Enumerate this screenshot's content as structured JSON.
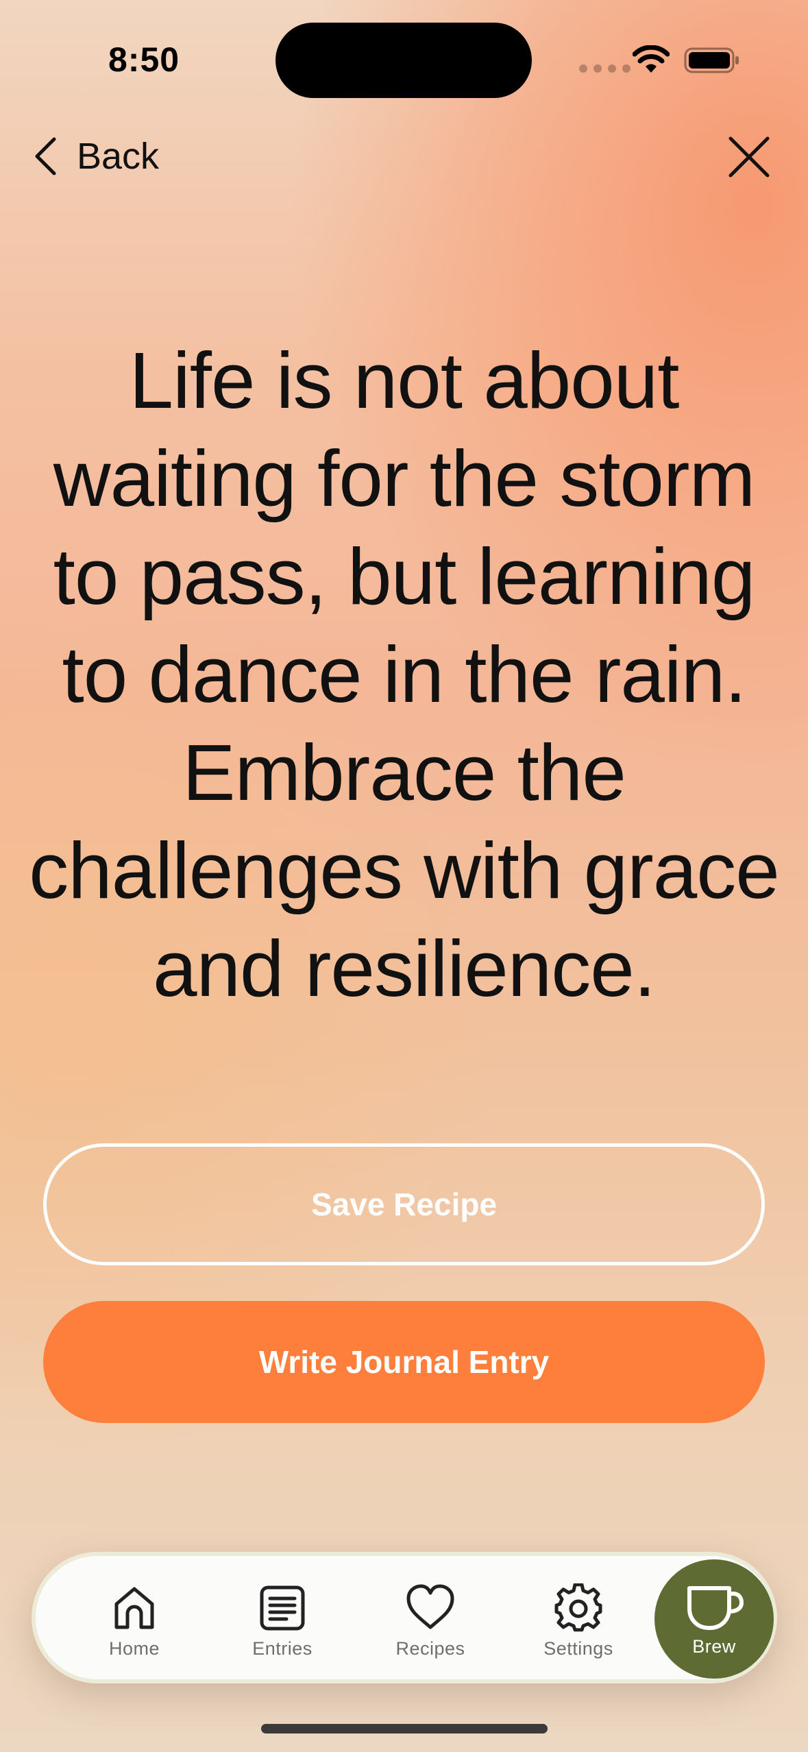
{
  "status_bar": {
    "time": "8:50"
  },
  "nav": {
    "back_label": "Back",
    "back_icon": "chevron-left-icon",
    "close_icon": "close-icon"
  },
  "quote": {
    "text": "Life is not about waiting for the storm to pass, but learning to dance in the rain. Embrace the challenges with grace and resilience."
  },
  "actions": {
    "save_recipe_label": "Save Recipe",
    "write_entry_label": "Write Journal Entry"
  },
  "tab_bar": {
    "items": [
      {
        "label": "Home",
        "icon": "home-icon"
      },
      {
        "label": "Entries",
        "icon": "entries-icon"
      },
      {
        "label": "Recipes",
        "icon": "heart-icon"
      },
      {
        "label": "Settings",
        "icon": "gear-icon"
      }
    ],
    "brew": {
      "label": "Brew",
      "icon": "cup-icon"
    }
  },
  "colors": {
    "accent_orange": "#fe7e3b",
    "brew_green": "#5e6b33",
    "tabbar_border": "#ecebd8"
  }
}
